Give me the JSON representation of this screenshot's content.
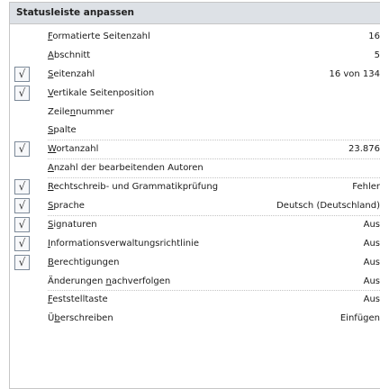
{
  "menu": {
    "title": "Statusleiste anpassen",
    "items": [
      {
        "label": "Formatierte Seitenzahl",
        "mnemonic": 0,
        "value": "16",
        "checked": false,
        "sep": false
      },
      {
        "label": "Abschnitt",
        "mnemonic": 0,
        "value": "5",
        "checked": false,
        "sep": false
      },
      {
        "label": "Seitenzahl",
        "mnemonic": 0,
        "value": "16 von 134",
        "checked": true,
        "sep": false
      },
      {
        "label": "Vertikale Seitenposition",
        "mnemonic": 0,
        "value": "",
        "checked": true,
        "sep": false
      },
      {
        "label": "Zeilennummer",
        "mnemonic": 5,
        "value": "",
        "checked": false,
        "sep": false
      },
      {
        "label": "Spalte",
        "mnemonic": 0,
        "value": "",
        "checked": false,
        "sep": true
      },
      {
        "label": "Wortanzahl",
        "mnemonic": 0,
        "value": "23.876",
        "checked": true,
        "sep": true
      },
      {
        "label": "Anzahl der bearbeitenden Autoren",
        "mnemonic": 0,
        "value": "",
        "checked": false,
        "sep": true
      },
      {
        "label": "Rechtschreib- und Grammatikprüfung",
        "mnemonic": 0,
        "value": "Fehler",
        "checked": true,
        "sep": false
      },
      {
        "label": "Sprache",
        "mnemonic": 0,
        "value": "Deutsch (Deutschland)",
        "checked": true,
        "sep": true
      },
      {
        "label": "Signaturen",
        "mnemonic": 0,
        "value": "Aus",
        "checked": true,
        "sep": false
      },
      {
        "label": "Informationsverwaltungsrichtlinie",
        "mnemonic": 0,
        "value": "Aus",
        "checked": true,
        "sep": false
      },
      {
        "label": "Berechtigungen",
        "mnemonic": 0,
        "value": "Aus",
        "checked": true,
        "sep": false
      },
      {
        "label": "Änderungen nachverfolgen",
        "mnemonic": 11,
        "value": "Aus",
        "checked": false,
        "sep": true
      },
      {
        "label": "Feststelltaste",
        "mnemonic": 0,
        "value": "Aus",
        "checked": false,
        "sep": false
      },
      {
        "label": "Überschreiben",
        "mnemonic": 1,
        "value": "Einfügen",
        "checked": false,
        "sep": false
      }
    ],
    "check_glyph": "√"
  }
}
